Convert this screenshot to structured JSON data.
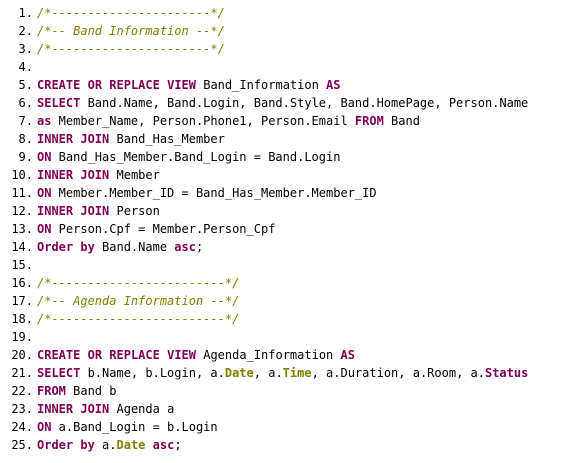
{
  "editor": {
    "lines": [
      {
        "num": "1.",
        "tokens": [
          [
            "cm",
            "/*----------------------*/"
          ]
        ]
      },
      {
        "num": "2.",
        "tokens": [
          [
            "cm",
            "/*-- Band Information --*/"
          ]
        ]
      },
      {
        "num": "3.",
        "tokens": [
          [
            "cm",
            "/*----------------------*/"
          ]
        ]
      },
      {
        "num": "4.",
        "tokens": []
      },
      {
        "num": "5.",
        "tokens": [
          [
            "kw",
            "CREATE"
          ],
          [
            "tx",
            " "
          ],
          [
            "kw",
            "OR"
          ],
          [
            "tx",
            " "
          ],
          [
            "kw",
            "REPLACE"
          ],
          [
            "tx",
            " "
          ],
          [
            "kw",
            "VIEW"
          ],
          [
            "tx",
            " Band_Information "
          ],
          [
            "kw",
            "AS"
          ]
        ]
      },
      {
        "num": "6.",
        "tokens": [
          [
            "kw",
            "SELECT"
          ],
          [
            "tx",
            " Band.Name, Band.Login, Band.Style, Band.HomePage, Person.Name"
          ]
        ]
      },
      {
        "num": "7.",
        "tokens": [
          [
            "kw",
            "as"
          ],
          [
            "tx",
            " Member_Name, Person.Phone1, Person.Email "
          ],
          [
            "kw",
            "FROM"
          ],
          [
            "tx",
            " Band"
          ]
        ]
      },
      {
        "num": "8.",
        "tokens": [
          [
            "kw",
            "INNER"
          ],
          [
            "tx",
            " "
          ],
          [
            "kw",
            "JOIN"
          ],
          [
            "tx",
            " Band_Has_Member"
          ]
        ]
      },
      {
        "num": "9.",
        "tokens": [
          [
            "kw",
            "ON"
          ],
          [
            "tx",
            " Band_Has_Member.Band_Login = Band.Login"
          ]
        ]
      },
      {
        "num": "10.",
        "tokens": [
          [
            "kw",
            "INNER"
          ],
          [
            "tx",
            " "
          ],
          [
            "kw",
            "JOIN"
          ],
          [
            "tx",
            " Member"
          ]
        ]
      },
      {
        "num": "11.",
        "tokens": [
          [
            "kw",
            "ON"
          ],
          [
            "tx",
            " Member.Member_ID = Band_Has_Member.Member_ID"
          ]
        ]
      },
      {
        "num": "12.",
        "tokens": [
          [
            "kw",
            "INNER"
          ],
          [
            "tx",
            " "
          ],
          [
            "kw",
            "JOIN"
          ],
          [
            "tx",
            " Person"
          ]
        ]
      },
      {
        "num": "13.",
        "tokens": [
          [
            "kw",
            "ON"
          ],
          [
            "tx",
            " Person.Cpf = Member.Person_Cpf"
          ]
        ]
      },
      {
        "num": "14.",
        "tokens": [
          [
            "kw",
            "Order"
          ],
          [
            "tx",
            " "
          ],
          [
            "kw",
            "by"
          ],
          [
            "tx",
            " Band.Name "
          ],
          [
            "kw",
            "asc"
          ],
          [
            "tx",
            ";"
          ]
        ]
      },
      {
        "num": "15.",
        "tokens": []
      },
      {
        "num": "16.",
        "tokens": [
          [
            "cm",
            "/*------------------------*/"
          ]
        ]
      },
      {
        "num": "17.",
        "tokens": [
          [
            "cm",
            "/*-- Agenda Information --*/"
          ]
        ]
      },
      {
        "num": "18.",
        "tokens": [
          [
            "cm",
            "/*------------------------*/"
          ]
        ]
      },
      {
        "num": "19.",
        "tokens": []
      },
      {
        "num": "20.",
        "tokens": [
          [
            "kw",
            "CREATE"
          ],
          [
            "tx",
            " "
          ],
          [
            "kw",
            "OR"
          ],
          [
            "tx",
            " "
          ],
          [
            "kw",
            "REPLACE"
          ],
          [
            "tx",
            " "
          ],
          [
            "kw",
            "VIEW"
          ],
          [
            "tx",
            " Agenda_Information "
          ],
          [
            "kw",
            "AS"
          ]
        ]
      },
      {
        "num": "21.",
        "tokens": [
          [
            "kw",
            "SELECT"
          ],
          [
            "tx",
            " b.Name, b.Login, a."
          ],
          [
            "hl",
            "Date"
          ],
          [
            "tx",
            ", a."
          ],
          [
            "hl",
            "Time"
          ],
          [
            "tx",
            ", a.Duration, a.Room, a."
          ],
          [
            "kw",
            "Status"
          ]
        ]
      },
      {
        "num": "22.",
        "tokens": [
          [
            "kw",
            "FROM"
          ],
          [
            "tx",
            " Band b"
          ]
        ]
      },
      {
        "num": "23.",
        "tokens": [
          [
            "kw",
            "INNER"
          ],
          [
            "tx",
            " "
          ],
          [
            "kw",
            "JOIN"
          ],
          [
            "tx",
            " Agenda a"
          ]
        ]
      },
      {
        "num": "24.",
        "tokens": [
          [
            "kw",
            "ON"
          ],
          [
            "tx",
            " a.Band_Login = b.Login"
          ]
        ]
      },
      {
        "num": "25.",
        "tokens": [
          [
            "kw",
            "Order"
          ],
          [
            "tx",
            " "
          ],
          [
            "kw",
            "by"
          ],
          [
            "tx",
            " a."
          ],
          [
            "hl",
            "Date"
          ],
          [
            "tx",
            " "
          ],
          [
            "kw",
            "asc"
          ],
          [
            "tx",
            ";"
          ]
        ]
      }
    ]
  }
}
